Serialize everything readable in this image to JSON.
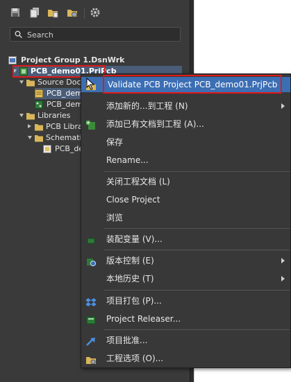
{
  "search": {
    "placeholder": "Search"
  },
  "tree": {
    "project_group": "Project Group 1.DsnWrk",
    "project": "PCB_demo01.PrjPcb",
    "source_docs": "Source Docu",
    "doc1": "PCB_demo",
    "doc2": "PCB_demo",
    "libraries": "Libraries",
    "pcb_libraries": "PCB Librari",
    "schematic_libraries": "Schematic",
    "schlib_doc": "PCB_dem"
  },
  "menu": {
    "validate": "Validate PCB Project PCB_demo01.PrjPcb",
    "add_new": "添加新的...到工程 (N)",
    "add_existing": "添加已有文档到工程 (A)...",
    "save": "保存",
    "rename": "Rename...",
    "close_docs": "关闭工程文档 (L)",
    "close_project": "Close Project",
    "browse": "浏览",
    "variants": "装配变量 (V)...",
    "version_control": "版本控制 (E)",
    "local_history": "本地历史 (T)",
    "packager": "项目打包 (P)...",
    "releaser": "Project Releaser...",
    "approval": "项目批准...",
    "options": "工程选项 (O)..."
  },
  "icons": {
    "toolbar": [
      "save-icon",
      "save-all-icon",
      "open-folder-icon",
      "folder-settings-icon",
      "gear-icon"
    ],
    "search": "search-icon",
    "cursor": "mouse-pointer-icon"
  },
  "colors": {
    "highlight": "#3c6eb4",
    "callout_red": "#e01818",
    "panel_bg": "#3a3a3a",
    "menu_bg": "#383838"
  }
}
